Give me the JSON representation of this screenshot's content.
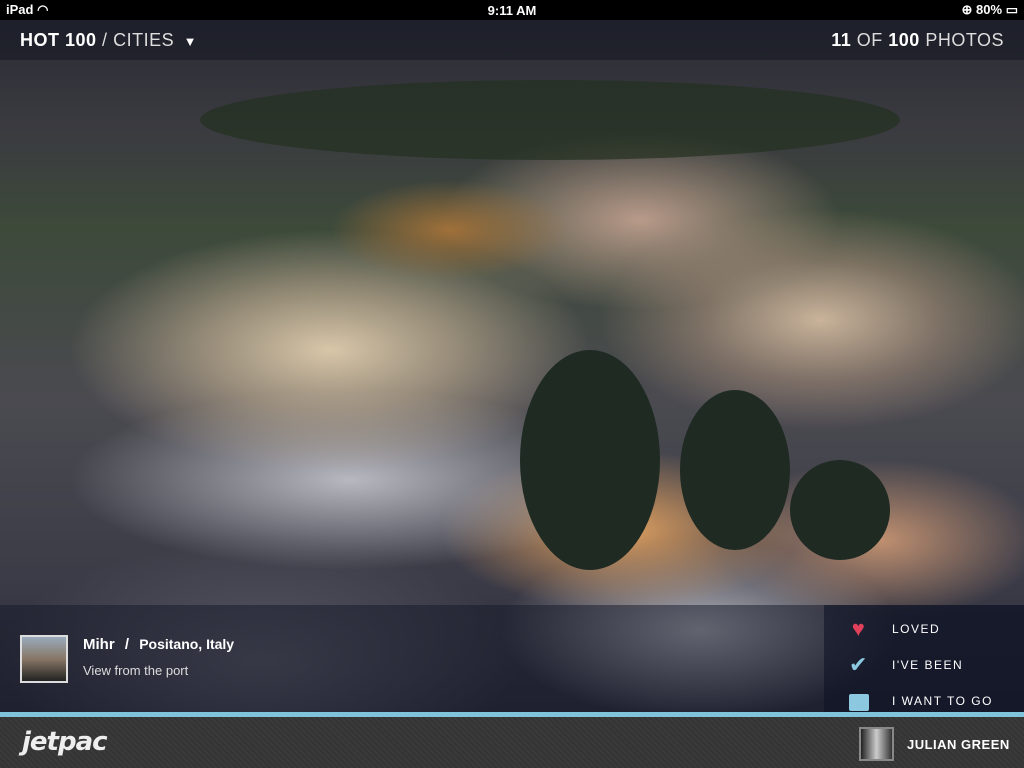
{
  "status_bar": {
    "device": "iPad",
    "time": "9:11 AM",
    "battery": "80%"
  },
  "header": {
    "section": "HOT 100",
    "separator": "/",
    "category": "CITIES",
    "photo_index": "11",
    "of": "OF",
    "photo_total": "100",
    "photos": "PHOTOS"
  },
  "caption": {
    "user": "Mihr",
    "separator": "/",
    "location": "Positano, Italy",
    "description": "View from the port"
  },
  "actions": [
    {
      "label": "LOVED",
      "icon": "heart-icon",
      "color": "#e0405a"
    },
    {
      "label": "I'VE BEEN",
      "icon": "check-icon",
      "color": "#8cc8e0"
    },
    {
      "label": "I WANT TO GO",
      "icon": "suitcase-icon",
      "color": "#8cc8e0"
    }
  ],
  "footer": {
    "logo": "jetpac",
    "user_name": "JULIAN GREEN"
  }
}
